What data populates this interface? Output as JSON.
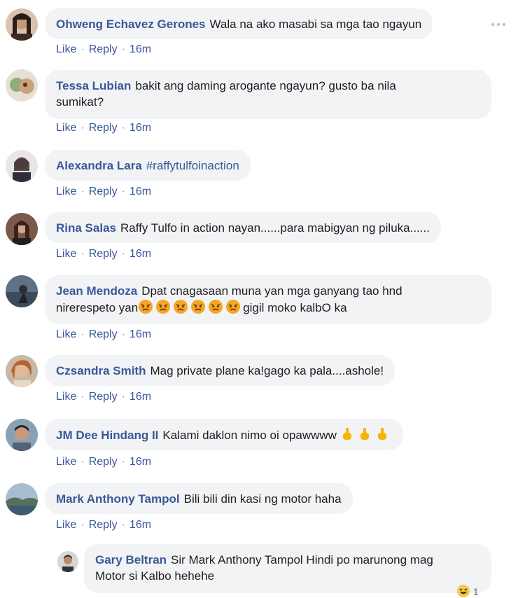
{
  "comments": [
    {
      "author": "Ohweng Echavez Gerones",
      "text": "Wala na ako masabi sa mga tao ngayun",
      "like": "Like",
      "reply": "Reply",
      "time": "16m"
    },
    {
      "author": "Tessa Lubian",
      "text": "bakit ang daming arogante ngayun? gusto ba nila",
      "text2": "sumikat?",
      "like": "Like",
      "reply": "Reply",
      "time": "16m"
    },
    {
      "author": "Alexandra Lara",
      "text": "#raffytulfoinaction",
      "like": "Like",
      "reply": "Reply",
      "time": "16m"
    },
    {
      "author": "Rina Salas",
      "text": "Raffy Tulfo in action nayan......para mabigyan ng piluka......",
      "like": "Like",
      "reply": "Reply",
      "time": "16m"
    },
    {
      "author": "Jean Mendoza",
      "text": "Dpat cnagasaan muna yan mga ganyang tao hnd",
      "text2a": "nirerespeto yan",
      "text2b": "gigil moko kalbO ka",
      "like": "Like",
      "reply": "Reply",
      "time": "16m"
    },
    {
      "author": "Czsandra Smith",
      "text": "Mag private plane ka!gago ka pala....ashole!",
      "like": "Like",
      "reply": "Reply",
      "time": "16m"
    },
    {
      "author": "JM Dee Hindang II",
      "text": "Kalami daklon nimo oi opawwww",
      "like": "Like",
      "reply": "Reply",
      "time": "16m"
    },
    {
      "author": "Mark Anthony Tampol",
      "text": "Bili bili din kasi ng motor haha",
      "like": "Like",
      "reply": "Reply",
      "time": "16m"
    }
  ],
  "reply": {
    "author": "Gary Beltran",
    "text": "Sir Mark Anthony Tampol Hindi po marunong mag",
    "text2": "Motor si Kalbo hehehe",
    "reaction_count": "1"
  },
  "icons": {
    "more": "more-options-icon",
    "angry": "angry-face-emoji",
    "middle_finger": "middle-finger-emoji",
    "haha": "haha-reaction-icon"
  },
  "colors": {
    "name": "#385898",
    "bubble": "#f2f3f5",
    "text": "#1c1e21"
  }
}
